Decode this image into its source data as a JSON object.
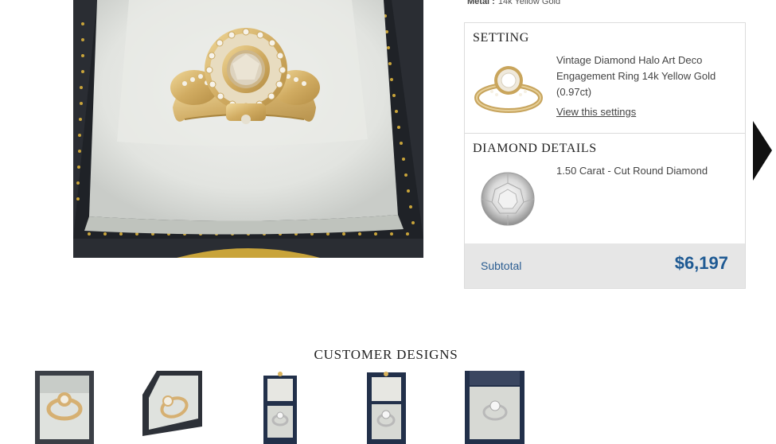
{
  "product": {
    "metal_label": "Metal :",
    "metal_value": "14k Yellow Gold",
    "main_image_alt": "ring-in-box-photo"
  },
  "summary": {
    "setting": {
      "title": "SETTING",
      "name": "Vintage Diamond Halo Art Deco Engagement Ring 14k Yellow Gold (0.97ct)",
      "link": "View this settings"
    },
    "diamond": {
      "title": "DIAMOND DETAILS",
      "name": "1.50 Carat - Cut Round Diamond"
    },
    "subtotal": {
      "label": "Subtotal",
      "value": "$6,197"
    }
  },
  "customer_designs": {
    "title": "CUSTOMER DESIGNS"
  },
  "colors": {
    "accent_blue": "#1f5a93",
    "subtotal_bg": "#e6e6e6",
    "gold": "#d8b56a"
  }
}
